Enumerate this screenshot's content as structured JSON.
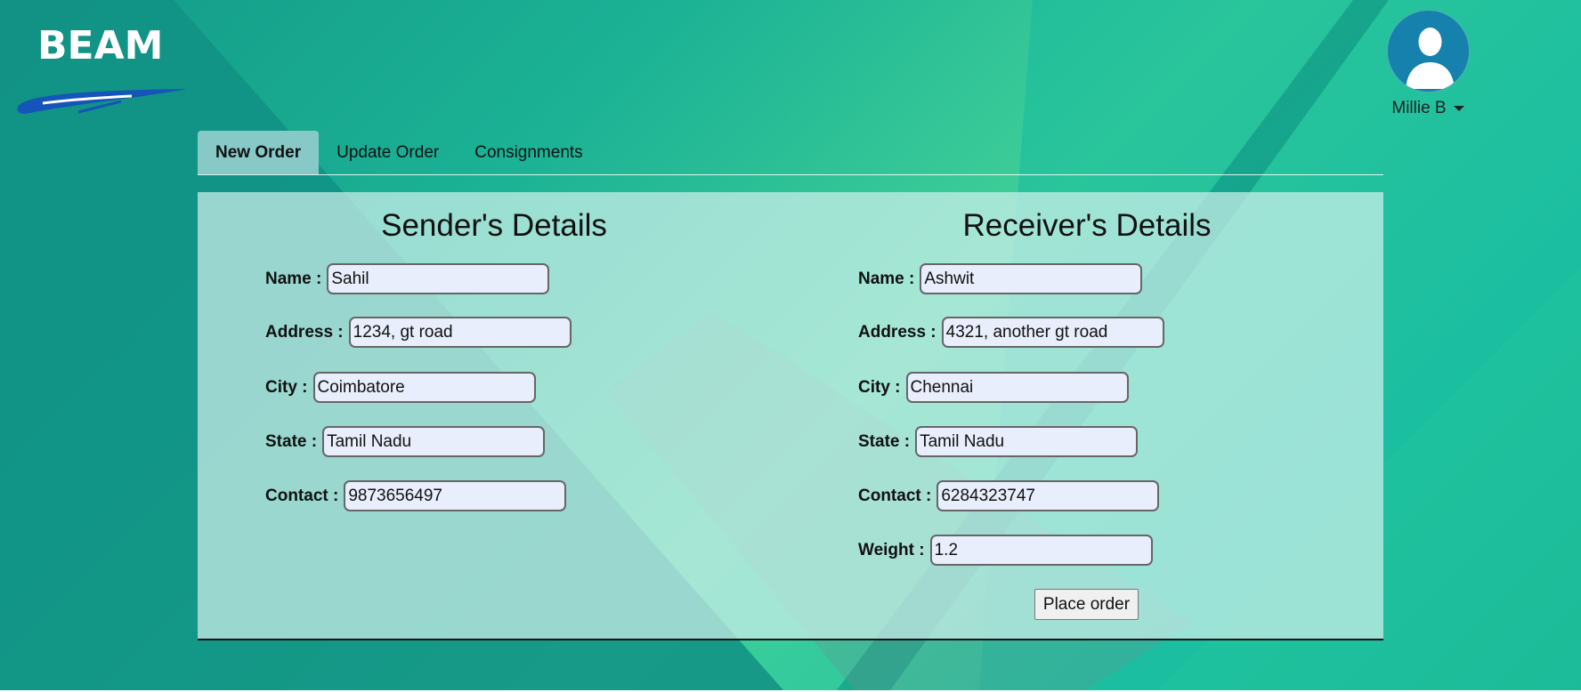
{
  "brand": {
    "logo_text": "BEAM"
  },
  "user": {
    "name": "Millie B"
  },
  "tabs": [
    {
      "label": "New Order"
    },
    {
      "label": "Update Order"
    },
    {
      "label": "Consignments"
    }
  ],
  "sender": {
    "title": "Sender's Details",
    "fields": [
      {
        "label": "Name :",
        "value": "Sahil"
      },
      {
        "label": "Address :",
        "value": "1234, gt road"
      },
      {
        "label": "City :",
        "value": "Coimbatore"
      },
      {
        "label": "State :",
        "value": "Tamil Nadu"
      },
      {
        "label": "Contact :",
        "value": "9873656497"
      }
    ]
  },
  "receiver": {
    "title": "Receiver's Details",
    "fields": [
      {
        "label": "Name :",
        "value": "Ashwit"
      },
      {
        "label": "Address :",
        "value": "4321, another gt road"
      },
      {
        "label": "City :",
        "value": "Chennai"
      },
      {
        "label": "State :",
        "value": "Tamil Nadu"
      },
      {
        "label": "Contact :",
        "value": "6284323747"
      },
      {
        "label": "Weight :",
        "value": "1.2"
      }
    ]
  },
  "actions": {
    "place_order_label": "Place order"
  },
  "colors": {
    "accent": "#1781ae",
    "active_tab": "#86c9c7"
  }
}
